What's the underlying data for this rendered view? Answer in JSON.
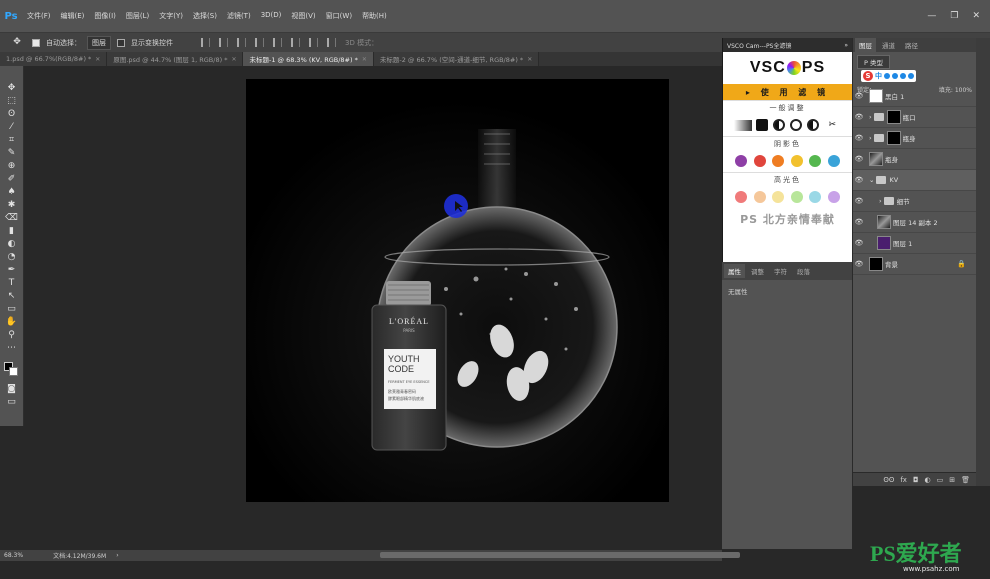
{
  "menubar": {
    "logo": "Ps",
    "items": [
      "文件(F)",
      "编辑(E)",
      "图像(I)",
      "图层(L)",
      "文字(Y)",
      "选择(S)",
      "滤镜(T)",
      "3D(D)",
      "视图(V)",
      "窗口(W)",
      "帮助(H)"
    ],
    "controls": [
      "—",
      "❐",
      "✕"
    ]
  },
  "options": {
    "auto_select_label": "自动选择：",
    "auto_select_value": "图层",
    "transform_label": "显示变换控件",
    "mode_label": "3D 模式："
  },
  "tabs": [
    {
      "label": "1.psd @ 66.7%(RGB/8#) *",
      "active": false
    },
    {
      "label": "原图.psd @ 44.7% (图层 1, RGB/8) *",
      "active": false
    },
    {
      "label": "未标题-1 @ 68.3% (KV, RGB/8#) *",
      "active": true
    },
    {
      "label": "未标题-2 @ 66.7% (空间-通道-细节, RGB/8#) *",
      "active": false
    }
  ],
  "toolbar": {
    "tools": [
      "✥",
      "⬚",
      "ʘ",
      "⁄",
      "⌗",
      "✎",
      "⊕",
      "✐",
      "♠",
      "✱",
      "⌫",
      "▮",
      "◐",
      "◔",
      "✒",
      "T",
      "↖",
      "▭",
      "✋",
      "⚲",
      "⋯"
    ]
  },
  "status": {
    "zoom": "68.3%",
    "doc": "文档:4.12M/39.6M",
    "arrow": "›"
  },
  "vsco": {
    "title": "VSCO Cam---PS全滤镜",
    "close": "»",
    "logo_left": "VSC",
    "logo_right": "PS",
    "apply": "▸ 使 用 滤 镜",
    "section_basic": "一般调整",
    "section_shadow": "阴影色",
    "section_highlight": "高光色",
    "credit": "PS 北方亲情奉献",
    "shadow_colors": [
      "#8e3fa6",
      "#e0453c",
      "#ef7d22",
      "#f2c12e",
      "#55b74f",
      "#3aa3d8"
    ],
    "highlight_colors": [
      "#f07a7a",
      "#f5c79a",
      "#f5e39a",
      "#b8e69a",
      "#9ad8e6",
      "#c8a2e8"
    ]
  },
  "properties": {
    "tabs": [
      "属性",
      "调整",
      "字符",
      "段落"
    ],
    "body": "无属性"
  },
  "layers": {
    "tabs": [
      "图层",
      "通道",
      "路径"
    ],
    "kind": "P 类型",
    "ime_zh": "中",
    "lock_label": "锁定：",
    "fill_label": "填充: 100%",
    "rows": [
      {
        "name": "黑白 1",
        "thumb": "white",
        "kind": "adjust"
      },
      {
        "name": "瓶口",
        "thumb": "black",
        "kind": "group"
      },
      {
        "name": "瓶身",
        "thumb": "black",
        "kind": "group"
      },
      {
        "name": "瓶身",
        "thumb": "mix",
        "kind": "layer"
      },
      {
        "name": "KV",
        "thumb": "",
        "kind": "group-open"
      },
      {
        "name": "细节",
        "thumb": "",
        "kind": "group"
      },
      {
        "name": "图层 14 副本 2",
        "thumb": "mix",
        "kind": "layer"
      },
      {
        "name": "图层 1",
        "thumb": "purple",
        "kind": "layer"
      },
      {
        "name": "背景",
        "thumb": "black",
        "kind": "bg"
      }
    ],
    "footer": [
      "ʘʘ",
      "fx",
      "◘",
      "◐",
      "▭",
      "⊞",
      "🗑"
    ]
  },
  "artwork": {
    "brand": "L'ORÉAL",
    "brand_sub": "PARIS",
    "line1": "YOUTH",
    "line2": "CODE",
    "tagline": "FERMENT EYE ESSENCE",
    "cn_text1": "欧莱雅青春密码",
    "cn_text2": "酵素眼部精华肌底液"
  },
  "watermark": {
    "text": "PS爱好者",
    "url": "www.psahz.com"
  },
  "colors": {
    "vsco_apply": "#f0a818",
    "ps_blue": "#31a8ff",
    "cursor_blue": "#1e2fd8",
    "watermark_green": "#2ea84f"
  }
}
